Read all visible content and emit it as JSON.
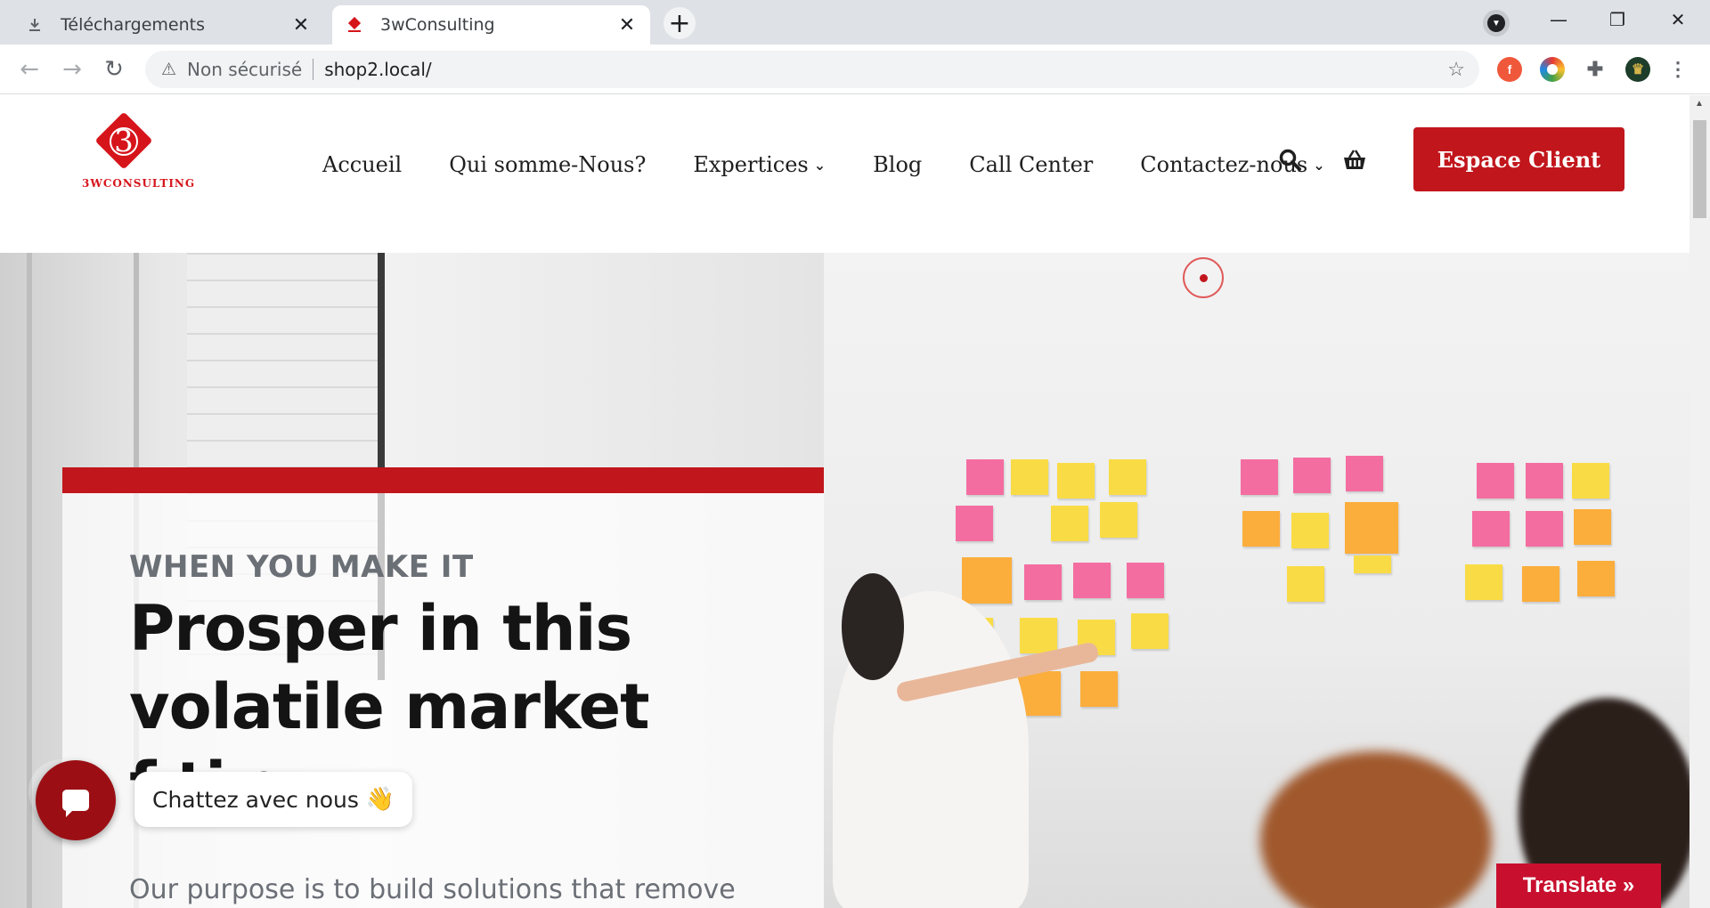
{
  "browser": {
    "tabs": [
      {
        "title": "Téléchargements",
        "icon": "download-icon"
      },
      {
        "title": "3wConsulting",
        "icon": "3w-favicon"
      }
    ],
    "new_tab_symbol": "+",
    "window_controls": {
      "minimize": "—",
      "restore": "❐",
      "close": "✕"
    },
    "address": {
      "security_label": "Non sécurisé",
      "url": "shop2.local/"
    },
    "extensions": [
      "facebook-ext-icon",
      "color-ext-icon",
      "puzzle-icon",
      "profile-avatar"
    ]
  },
  "site": {
    "logo": {
      "numeral": "3",
      "brand": "3WCONSULTING"
    },
    "nav": [
      {
        "label": "Accueil",
        "dropdown": false
      },
      {
        "label": "Qui somme-Nous?",
        "dropdown": false
      },
      {
        "label": "Expertices",
        "dropdown": true
      },
      {
        "label": "Blog",
        "dropdown": false
      },
      {
        "label": "Call Center",
        "dropdown": false
      },
      {
        "label": "Contactez-nous",
        "dropdown": true
      }
    ],
    "cta_label": "Espace Client",
    "accent_color": "#c1161c"
  },
  "hero": {
    "eyebrow": "WHEN YOU MAKE IT",
    "headline_line1": "Prosper in this",
    "headline_line2": "volatile market",
    "headline_line3": "f  ti g",
    "subtext": "Our purpose is to build solutions that remove"
  },
  "chat": {
    "label": "Chattez avec nous",
    "emoji": "👋"
  },
  "translate_label": "Translate »"
}
